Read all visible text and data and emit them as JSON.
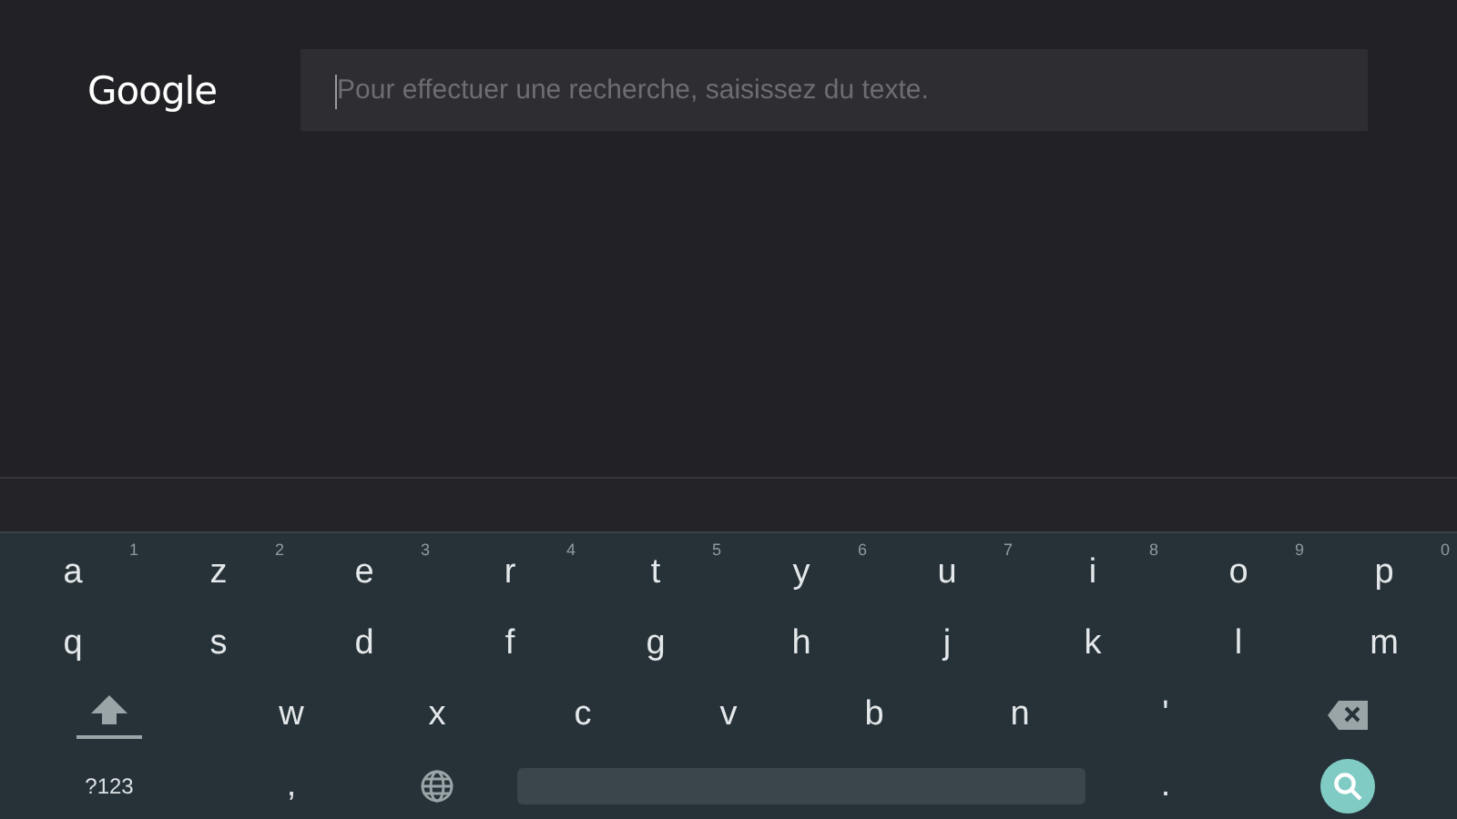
{
  "header": {
    "logo": "Google",
    "search": {
      "placeholder": "Pour effectuer une recherche, saisissez du texte."
    }
  },
  "keyboard": {
    "rows": [
      [
        {
          "kind": "char",
          "label": "a",
          "hint": "1"
        },
        {
          "kind": "char",
          "label": "z",
          "hint": "2"
        },
        {
          "kind": "char",
          "label": "e",
          "hint": "3"
        },
        {
          "kind": "char",
          "label": "r",
          "hint": "4"
        },
        {
          "kind": "char",
          "label": "t",
          "hint": "5"
        },
        {
          "kind": "char",
          "label": "y",
          "hint": "6"
        },
        {
          "kind": "char",
          "label": "u",
          "hint": "7"
        },
        {
          "kind": "char",
          "label": "i",
          "hint": "8"
        },
        {
          "kind": "char",
          "label": "o",
          "hint": "9"
        },
        {
          "kind": "char",
          "label": "p",
          "hint": "0"
        }
      ],
      [
        {
          "kind": "char",
          "label": "q"
        },
        {
          "kind": "char",
          "label": "s"
        },
        {
          "kind": "char",
          "label": "d"
        },
        {
          "kind": "char",
          "label": "f"
        },
        {
          "kind": "char",
          "label": "g"
        },
        {
          "kind": "char",
          "label": "h"
        },
        {
          "kind": "char",
          "label": "j"
        },
        {
          "kind": "char",
          "label": "k"
        },
        {
          "kind": "char",
          "label": "l"
        },
        {
          "kind": "char",
          "label": "m"
        }
      ],
      [
        {
          "kind": "shift"
        },
        {
          "kind": "char",
          "label": "w"
        },
        {
          "kind": "char",
          "label": "x"
        },
        {
          "kind": "char",
          "label": "c"
        },
        {
          "kind": "char",
          "label": "v"
        },
        {
          "kind": "char",
          "label": "b"
        },
        {
          "kind": "char",
          "label": "n"
        },
        {
          "kind": "char",
          "label": "'"
        },
        {
          "kind": "backspace"
        }
      ],
      [
        {
          "kind": "symbols",
          "label": "?123"
        },
        {
          "kind": "char",
          "label": ","
        },
        {
          "kind": "globe"
        },
        {
          "kind": "space"
        },
        {
          "kind": "char",
          "label": "."
        },
        {
          "kind": "search"
        }
      ]
    ]
  }
}
